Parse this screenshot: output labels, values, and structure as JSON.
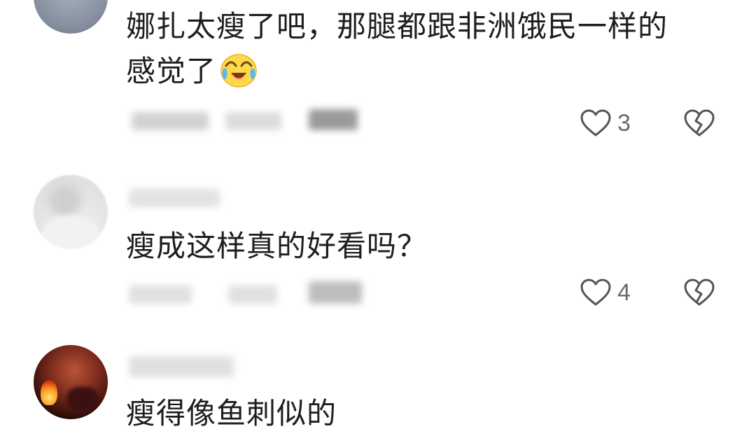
{
  "comments": [
    {
      "username": "",
      "text_line1": "娜扎太瘦了吧，那腿都跟非洲饿民一样的",
      "text_line2": "感觉了",
      "emoji": "crying-laughing-emoji",
      "meta_time": "",
      "meta_location": "",
      "reply_label": "",
      "like_count": "3"
    },
    {
      "username": "",
      "text_line1": "瘦成这样真的好看吗？",
      "meta_time": "",
      "meta_location": "",
      "reply_label": "",
      "like_count": "4"
    },
    {
      "username": "",
      "text_line1": "瘦得像鱼刺似的"
    }
  ],
  "icons": {
    "like": "heart-outline-icon",
    "dislike": "broken-heart-icon"
  },
  "colors": {
    "text": "#1e1e1e",
    "secondary": "#6b6b6b",
    "icon": "#555555"
  }
}
